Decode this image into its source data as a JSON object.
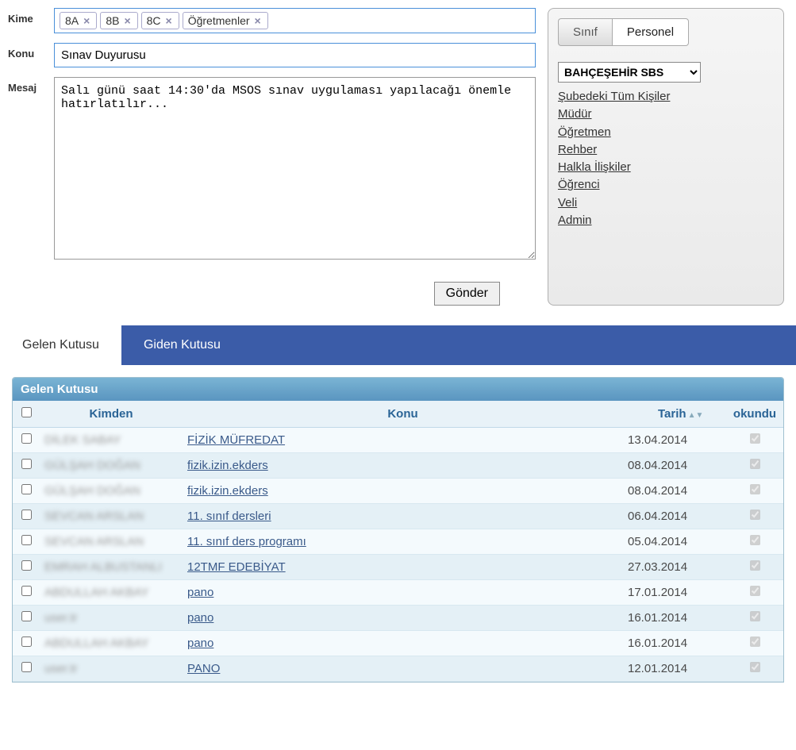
{
  "labels": {
    "kime": "Kime",
    "konu": "Konu",
    "mesaj": "Mesaj"
  },
  "recipients": [
    "8A",
    "8B",
    "8C",
    "Öğretmenler"
  ],
  "subject": "Sınav Duyurusu",
  "message": "Salı günü saat 14:30'da MSOS sınav uygulaması yapılacağı önemle hatırlatılır...",
  "send_button": "Gönder",
  "sidebar": {
    "tabs": {
      "sinif": "Sınıf",
      "personel": "Personel"
    },
    "active_tab": "personel",
    "school": "BAHÇEŞEHİR SBS",
    "roles": [
      "Şubedeki Tüm Kişiler",
      "Müdür",
      "Öğretmen",
      "Rehber",
      "Halkla İlişkiler",
      "Öğrenci",
      "Veli",
      "Admin"
    ]
  },
  "mailbox_tabs": {
    "gelen": "Gelen Kutusu",
    "giden": "Giden Kutusu"
  },
  "inbox": {
    "title": "Gelen Kutusu",
    "columns": {
      "from": "Kimden",
      "subject": "Konu",
      "date": "Tarih",
      "read": "okundu"
    },
    "rows": [
      {
        "from": "DİLEK SABAY",
        "subject": "FİZİK MÜFREDAT",
        "date": "13.04.2014",
        "read": true
      },
      {
        "from": "GÜLŞAH DOĞAN",
        "subject": "fizik.izin.ekders",
        "date": "08.04.2014",
        "read": true
      },
      {
        "from": "GÜLŞAH DOĞAN",
        "subject": "fizik.izin.ekders",
        "date": "08.04.2014",
        "read": true
      },
      {
        "from": "SEVCAN ARSLAN",
        "subject": "11. sınıf dersleri",
        "date": "06.04.2014",
        "read": true
      },
      {
        "from": "SEVCAN ARSLAN",
        "subject": "11. sınıf ders programı",
        "date": "05.04.2014",
        "read": true
      },
      {
        "from": "EMRAH ALBUSTANLI",
        "subject": "12TMF EDEBİYAT",
        "date": "27.03.2014",
        "read": true
      },
      {
        "from": "ABDULLAH AKBAY",
        "subject": "pano",
        "date": "17.01.2014",
        "read": true
      },
      {
        "from": "user.tr",
        "subject": "pano",
        "date": "16.01.2014",
        "read": true
      },
      {
        "from": "ABDULLAH AKBAY",
        "subject": "pano",
        "date": "16.01.2014",
        "read": true
      },
      {
        "from": "user.tr",
        "subject": "PANO",
        "date": "12.01.2014",
        "read": true
      }
    ]
  }
}
